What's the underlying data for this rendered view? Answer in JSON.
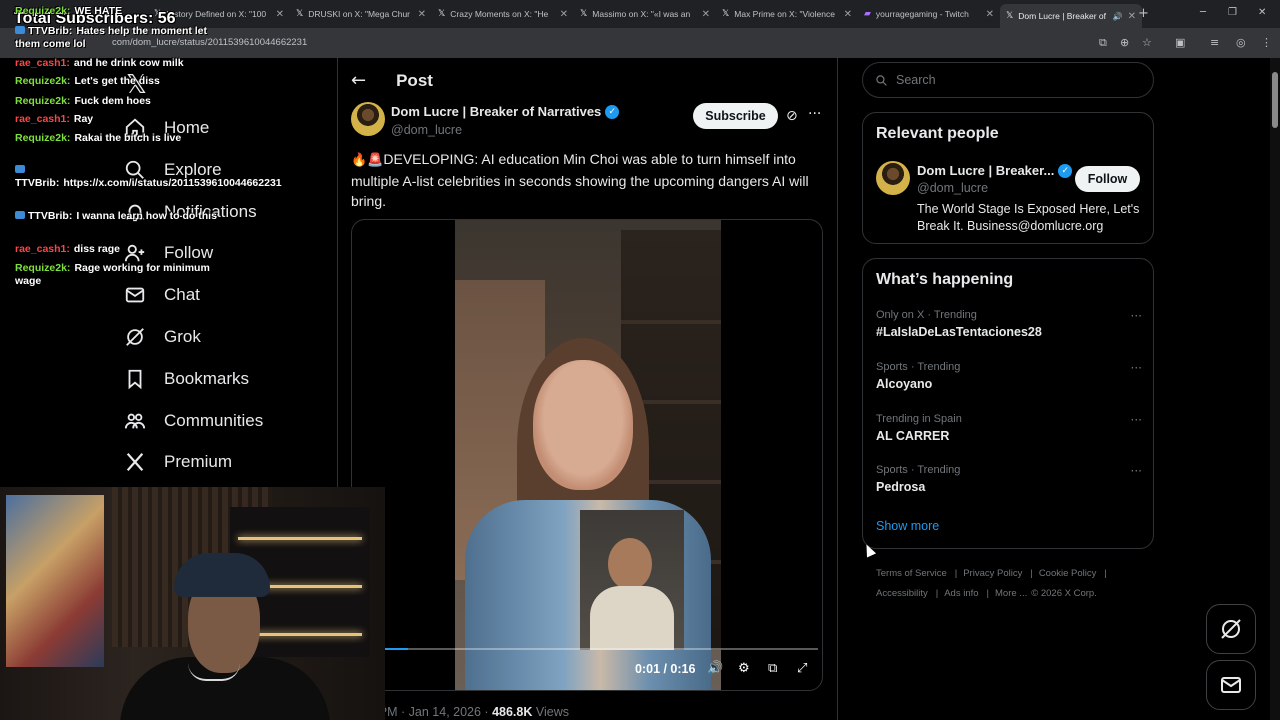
{
  "browser": {
    "tabs": [
      {
        "icon": "x-icon",
        "title": "History Defined on X: \"100"
      },
      {
        "icon": "x-icon",
        "title": "DRUSKI on X: \"Mega Chur"
      },
      {
        "icon": "x-icon",
        "title": "Crazy Moments on X: \"He"
      },
      {
        "icon": "x-icon",
        "title": "Massimo on X: \"«I was an"
      },
      {
        "icon": "x-icon",
        "title": "Max Prime on X: \"Violence"
      },
      {
        "icon": "twitch-icon",
        "title": "yourragegaming - Twitch"
      },
      {
        "icon": "x-icon",
        "title": "Dom Lucre | Breaker of",
        "active": true
      }
    ],
    "url": "com/dom_lucre/status/2011539610044662231"
  },
  "overlay": {
    "subscribers": "Total Subscribers: 56",
    "chat": [
      {
        "user": "Requize2k:",
        "color": "#7ee03d",
        "text": "WE HATE",
        "badge": false
      },
      {
        "user": "TTVBrib:",
        "color": "#ffffff",
        "text": "Hates help the moment let them come lol",
        "badge": true
      },
      {
        "user": "rae_cash1:",
        "color": "#ff4545",
        "text": "and he drink cow milk",
        "badge": false
      },
      {
        "user": "Requize2k:",
        "color": "#7ee03d",
        "text": "Let's get the diss",
        "badge": false
      },
      {
        "user": "Requize2k:",
        "color": "#7ee03d",
        "text": "Fuck dem hoes",
        "badge": false
      },
      {
        "user": "rae_cash1:",
        "color": "#ff4545",
        "text": "Ray",
        "badge": false
      },
      {
        "user": "Requize2k:",
        "color": "#7ee03d",
        "text": "Rakai the bitch is live",
        "badge": false
      },
      {
        "user": "TTVBrib:",
        "color": "#ffffff",
        "text": "https://x.com/i/status/2011539610044662231",
        "badge": true
      },
      {
        "user": "TTVBrib:",
        "color": "#ffffff",
        "text": "I wanna learn how to do this",
        "badge": true
      },
      {
        "user": "rae_cash1:",
        "color": "#ff4545",
        "text": "diss rage",
        "badge": false
      },
      {
        "user": "Requize2k:",
        "color": "#7ee03d",
        "text": "Rage working for minimum wage",
        "badge": false
      }
    ]
  },
  "nav": {
    "items": [
      {
        "label": "Home",
        "icon": "home-icon"
      },
      {
        "label": "Explore",
        "icon": "search-icon"
      },
      {
        "label": "Notifications",
        "icon": "bell-icon"
      },
      {
        "label": "Follow",
        "icon": "follow-icon"
      },
      {
        "label": "Chat",
        "icon": "mail-icon"
      },
      {
        "label": "Grok",
        "icon": "grok-icon"
      },
      {
        "label": "Bookmarks",
        "icon": "bookmark-icon"
      },
      {
        "label": "Communities",
        "icon": "communities-icon"
      },
      {
        "label": "Premium",
        "icon": "x-icon"
      }
    ]
  },
  "post": {
    "header": "Post",
    "author_name": "Dom Lucre | Breaker of Narratives",
    "author_handle": "@dom_lucre",
    "subscribe_label": "Subscribe",
    "text": "DEVELOPING: AI education Min Choi was able to turn himself into multiple A-list celebrities in seconds showing the upcoming dangers AI will bring.",
    "video_time": "0:01 / 0:16",
    "video_progress": 0.06,
    "timestamp": "3:43 PM · Jan 14, 2026 · ",
    "views_count": "486.8K",
    "views_label": " Views"
  },
  "sidebar": {
    "search_placeholder": "Search",
    "relevant_title": "Relevant people",
    "relevant_name": "Dom Lucre | Breaker...",
    "relevant_handle": "@dom_lucre",
    "relevant_bio": "The World Stage Is Exposed Here, Let's Break It. Business@domlucre.org",
    "follow_label": "Follow",
    "happening_title": "What’s happening",
    "trends": [
      {
        "context": "Only on X · Trending",
        "name": "#LaIslaDeLasTentaciones28"
      },
      {
        "context": "Sports · Trending",
        "name": "Alcoyano"
      },
      {
        "context": "Trending in Spain",
        "name": "AL CARRER"
      },
      {
        "context": "Sports · Trending",
        "name": "Pedrosa"
      }
    ],
    "show_more": "Show more",
    "footer_links": [
      "Terms of Service",
      "Privacy Policy",
      "Cookie Policy",
      "Accessibility",
      "Ads info",
      "More ..."
    ],
    "copyright": "© 2026 X Corp."
  },
  "colors": {
    "accent": "#1d9bf0",
    "background": "#000000",
    "border": "#2f3336",
    "muted": "#71767b"
  }
}
